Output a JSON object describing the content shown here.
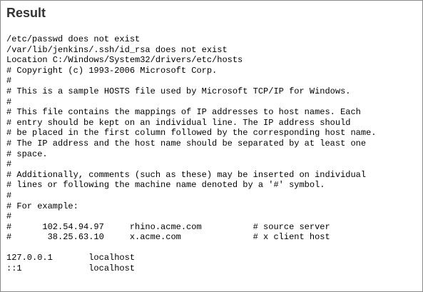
{
  "panel": {
    "title": "Result"
  },
  "output": {
    "lines": [
      "/etc/passwd does not exist",
      "/var/lib/jenkins/.ssh/id_rsa does not exist",
      "Location C:/Windows/System32/drivers/etc/hosts",
      "# Copyright (c) 1993-2006 Microsoft Corp.",
      "#",
      "# This is a sample HOSTS file used by Microsoft TCP/IP for Windows.",
      "#",
      "# This file contains the mappings of IP addresses to host names. Each",
      "# entry should be kept on an individual line. The IP address should",
      "# be placed in the first column followed by the corresponding host name.",
      "# The IP address and the host name should be separated by at least one",
      "# space.",
      "#",
      "# Additionally, comments (such as these) may be inserted on individual",
      "# lines or following the machine name denoted by a '#' symbol.",
      "#",
      "# For example:",
      "#",
      "#      102.54.94.97     rhino.acme.com          # source server",
      "#       38.25.63.10     x.acme.com              # x client host",
      "",
      "127.0.0.1       localhost",
      "::1             localhost"
    ]
  }
}
